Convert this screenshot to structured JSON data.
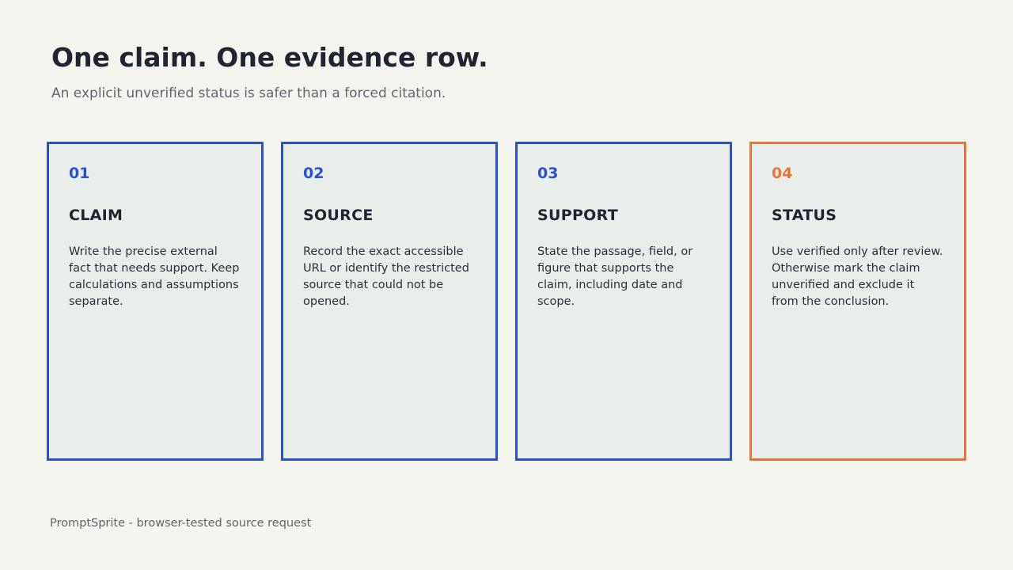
{
  "page": {
    "title": "One claim. One evidence row.",
    "subtitle": "An explicit unverified status is safer than a forced citation."
  },
  "cards": [
    {
      "number": "01",
      "title": "CLAIM",
      "body": "Write the precise external fact that needs support. Keep calculations and assumptions separate."
    },
    {
      "number": "02",
      "title": "SOURCE",
      "body": "Record the exact accessible URL or identify the restricted source that could not be opened."
    },
    {
      "number": "03",
      "title": "SUPPORT",
      "body": "State the passage, field, or figure that supports the claim, including date and scope."
    },
    {
      "number": "04",
      "title": "STATUS",
      "body": "Use verified only after review. Otherwise mark the claim unverified and exclude it from the conclusion."
    }
  ],
  "footer": {
    "text": "PromptSprite - browser-tested source request"
  },
  "colors": {
    "background": "#f5f5f0",
    "card_background": "#e9eeeb",
    "primary_accent": "#2d4fcb",
    "status_accent": "#e8743b",
    "heading_text": "#1f2430",
    "muted_text": "#5f6670"
  }
}
